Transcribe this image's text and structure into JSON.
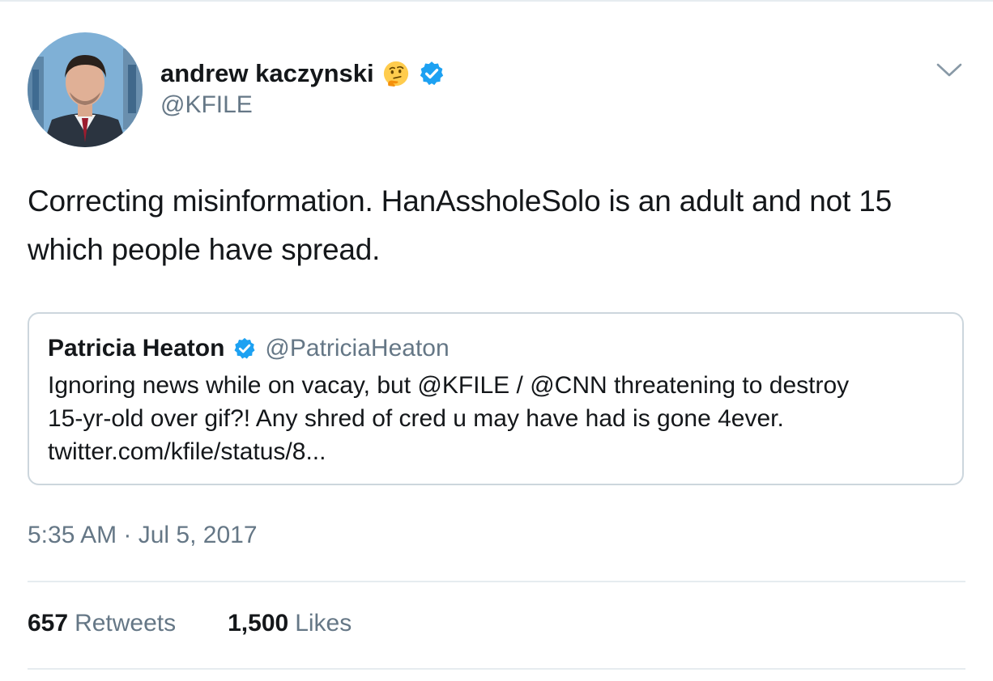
{
  "author": {
    "display_name": "andrew kaczynski",
    "handle": "@KFILE",
    "status_emoji_icon": "thinking-face-icon",
    "verified": true
  },
  "tweet": {
    "text_lines": [
      "Correcting misinformation. HanAssholeSolo is an adult and not 15",
      "which people have spread."
    ],
    "timestamp": "5:35 AM · Jul 5, 2017"
  },
  "quoted_tweet": {
    "display_name": "Patricia Heaton",
    "handle": "@PatriciaHeaton",
    "verified": true,
    "text_lines": [
      "Ignoring news while on vacay, but @KFILE / @CNN threatening to destroy",
      "15-yr-old over gif?! Any shred of cred u may have had is gone 4ever.",
      "twitter.com/kfile/status/8..."
    ]
  },
  "stats": {
    "retweets_count": "657",
    "retweets_label": "Retweets",
    "likes_count": "1,500",
    "likes_label": "Likes"
  },
  "icons": {
    "menu": "chevron-down-icon",
    "verified": "verified-badge-icon"
  },
  "colors": {
    "text": "#14171a",
    "secondary": "#657786",
    "verified_blue": "#1da1f2",
    "border": "#ccd6dd",
    "divider": "#e6ecf0"
  }
}
